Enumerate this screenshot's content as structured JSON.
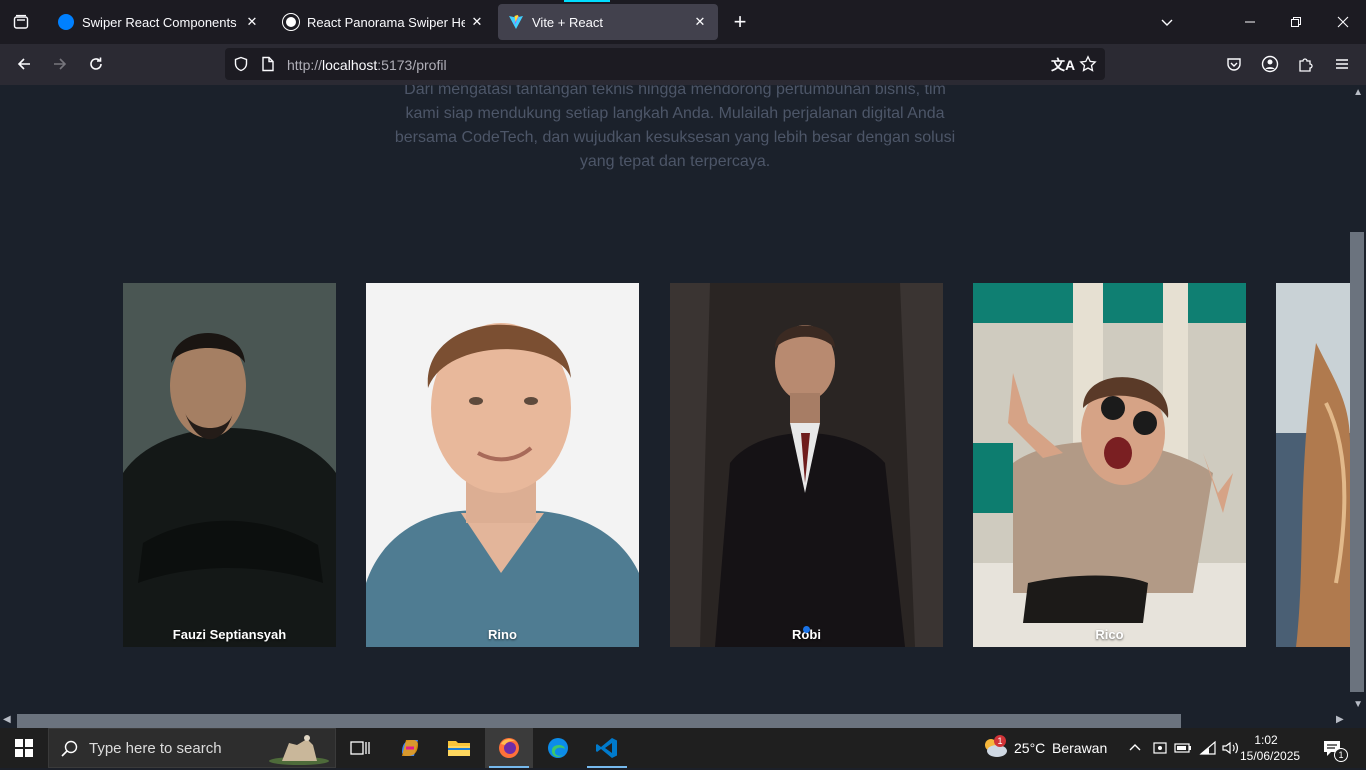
{
  "browser": {
    "tabs": [
      {
        "title": "Swiper React Components",
        "favicon": "swiper-logo-icon",
        "color": "#0080ff"
      },
      {
        "title": "React Panorama Swiper Help",
        "favicon": "openai-logo-icon",
        "color": "#ffffff"
      },
      {
        "title": "Vite + React",
        "favicon": "vite-logo-icon",
        "color": "#bd34fe",
        "active": true
      }
    ],
    "url": {
      "scheme": "http://",
      "host": "localhost",
      "rest": ":5173/profil"
    }
  },
  "page": {
    "intro_text": "Dari mengatasi tantangan teknis hingga mendorong pertumbuhan bisnis, tim kami siap mendukung setiap langkah Anda. Mulailah perjalanan digital Anda bersama CodeTech, dan wujudkan kesuksesan yang lebih besar dengan solusi yang tepat dan terpercaya.",
    "team": [
      {
        "name": "Fauzi Septiansyah"
      },
      {
        "name": "Rino"
      },
      {
        "name": "Robi"
      },
      {
        "name": "Rico"
      },
      {
        "name": ""
      }
    ]
  },
  "taskbar": {
    "search_placeholder": "Type here to search",
    "weather": {
      "temp": "25°C",
      "condition": "Berawan",
      "badge": "1"
    },
    "time": "1:02",
    "date": "15/06/2025",
    "notification_count": "1"
  }
}
